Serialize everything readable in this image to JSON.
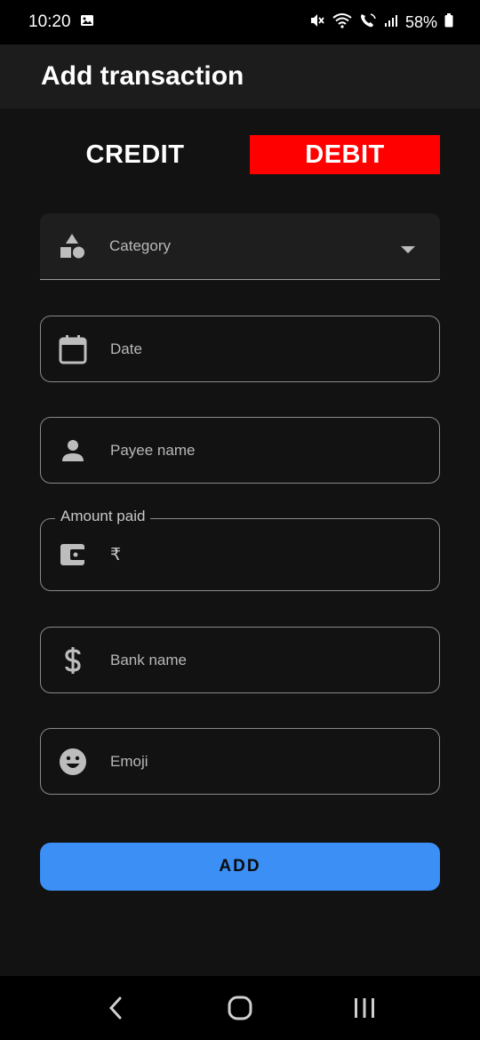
{
  "status_bar": {
    "time": "10:20",
    "battery": "58%",
    "icons": [
      "image-icon",
      "mute-icon",
      "wifi-icon",
      "call-icon",
      "signal-icon",
      "battery-icon"
    ]
  },
  "app_bar": {
    "title": "Add transaction"
  },
  "toggle": {
    "credit_label": "CREDIT",
    "debit_label": "DEBIT",
    "selected": "DEBIT",
    "selected_color": "#ff0000"
  },
  "form": {
    "category": {
      "label": "Category",
      "icon": "category-icon"
    },
    "date": {
      "label": "Date",
      "icon": "calendar-icon"
    },
    "payee": {
      "label": "Payee name",
      "icon": "person-icon"
    },
    "amount": {
      "label": "Amount paid",
      "prefix": "₹",
      "icon": "wallet-icon"
    },
    "bank": {
      "label": "Bank name",
      "icon": "dollar-icon"
    },
    "emoji": {
      "label": "Emoji",
      "icon": "emoji-icon"
    }
  },
  "add_button": {
    "label": "ADD",
    "color": "#3b8ff5"
  },
  "nav_bar": {
    "icons": [
      "back-icon",
      "home-icon",
      "recents-icon"
    ]
  }
}
